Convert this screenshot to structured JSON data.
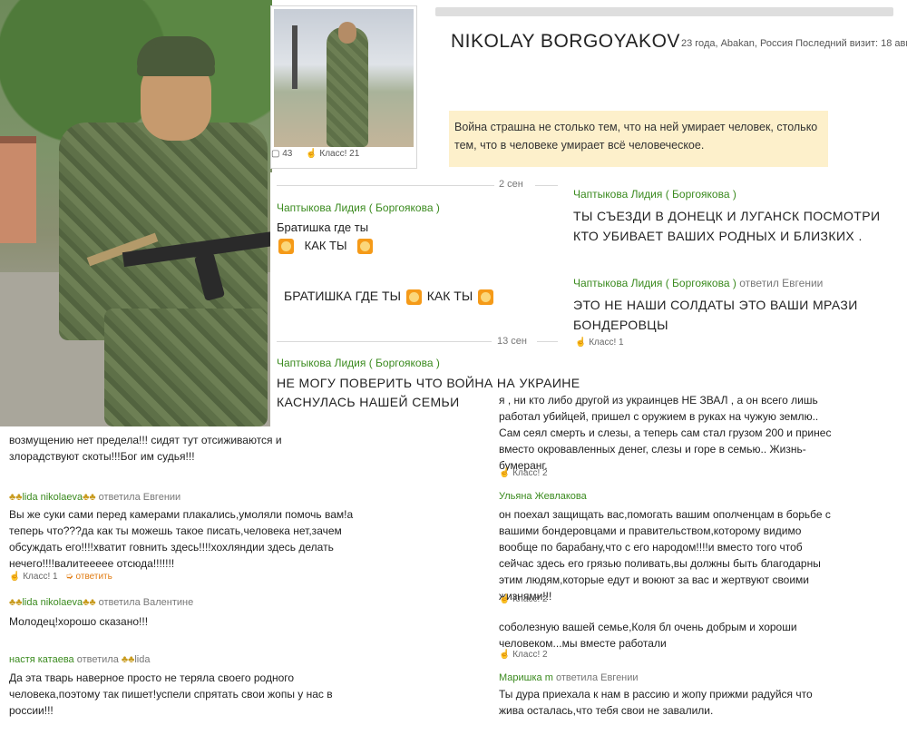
{
  "profile": {
    "name": "NIKOLAY BORGOYAKOV",
    "meta": "23 года, Abakan, Россия  Последний визит: 18 авг",
    "status_quote": "Война страшна не столько тем, что на ней умирает человек, столько тем, что в человеке умирает всё человеческое.",
    "thumb_comments": "43",
    "thumb_likes": "Класс! 21"
  },
  "dates": {
    "d1": "2 сен",
    "d2": "13 сен"
  },
  "left_comments": [
    {
      "author": "Чаптыкова Лидия ( Боргоякова )",
      "text": "Братишка где ты",
      "text2": "КАК ТЫ"
    },
    {
      "text": "БРАТИШКА ГДЕ ТЫ",
      "text2": "КАК ТЫ"
    },
    {
      "author": "Чаптыкова Лидия ( Боргоякова )",
      "text": "НЕ МОГУ ПОВЕРИТЬ ЧТО ВОЙНА НА УКРАИНЕ КАСНУЛАСЬ НАШЕЙ СЕМЬИ"
    }
  ],
  "right_comments": [
    {
      "author": "Чаптыкова Лидия ( Боргоякова )",
      "text": "ТЫ СЪЕЗДИ В ДОНЕЦК И ЛУГАНСК  ПОСМОТРИ КТО УБИВАЕТ ВАШИХ РОДНЫХ И БЛИЗКИХ ."
    },
    {
      "author": "Чаптыкова Лидия ( Боргоякова )",
      "reply": "ответил Евгении",
      "text": "ЭТО НЕ НАШИ СОЛДАТЫ  ЭТО ВАШИ МРАЗИ БОНДЕРОВЦЫ",
      "like": "Класс! 1"
    }
  ],
  "bottom_left": [
    {
      "text": "возмущению нет предела!!! сидят тут отсиживаются и злорадствуют скоты!!!Бог им судья!!!"
    },
    {
      "author": "lida nikolaeva",
      "reply": "ответила Евгении",
      "text": "Вы же суки сами перед камерами плакались,умоляли помочь вам!а теперь что???да как ты можешь такое писать,человека нет,зачем обсуждать его!!!!хватит говнить здесь!!!!хохляндии здесь делать нечего!!!!валитеееее отсюда!!!!!!!",
      "like": "Класс! 1",
      "reply_btn": "ответить"
    },
    {
      "author": "lida nikolaeva",
      "reply": "ответила Валентине",
      "text": "Молодец!хорошо сказано!!!"
    },
    {
      "author": "настя катаева",
      "reply": "ответила",
      "reply_to": "lida",
      "text": "Да эта тварь наверное просто не теряла своего родного человека,поэтому так пишет!успели спрятать свои жопы у нас в россии!!!"
    }
  ],
  "bottom_right": [
    {
      "text": "я , ни кто либо другой из украинцев НЕ ЗВАЛ , а он всего лишь работал убийцей, пришел с оружием в руках на чужую землю.. Сам сеял смерть и слезы, а теперь сам стал грузом 200 и принес вместо окровавленных денег, слезы и горе в семью.. Жизнь- бумеранг.",
      "like": "Класс! 2"
    },
    {
      "author": "Ульяна Жевлакова",
      "text": "он поехал защищать вас,помогать вашим ополченцам в борьбе с вашими бондеровцами и правительством,которому видимо вообще по барабану,что с его народом!!!!и вместо того чтоб сейчас здесь его грязью поливать,вы должны быть благодарны этим людям,которые едут и воюют за вас и жертвуют своими жизнями!!!",
      "like": "Класс! 2"
    },
    {
      "text": "соболезную вашей семье,Коля бл очень добрым и хороши человеком...мы вместе работали",
      "like": "Класс! 2"
    },
    {
      "author": "Маришка m",
      "reply": "ответила Евгении",
      "text": "Ты дура приехала к нам в рассию и жопу прижми радуйся что жива осталась,что тебя свои не завалили."
    }
  ]
}
